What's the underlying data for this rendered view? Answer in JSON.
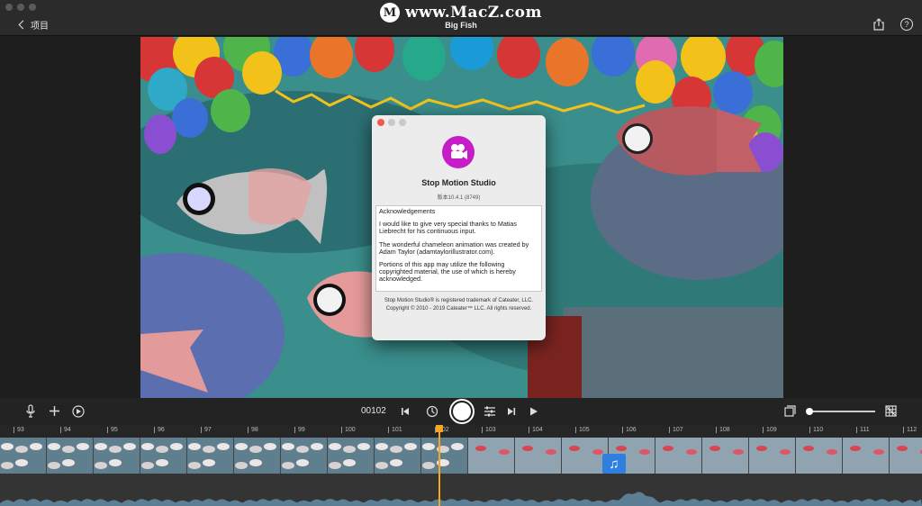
{
  "titlebar": {
    "back_label": "项目",
    "watermark_logo": "M",
    "watermark_text": "www.MacZ.com",
    "document_title": "Big Fish",
    "help_glyph": "?"
  },
  "about_dialog": {
    "app_name": "Stop Motion Studio",
    "version": "版本10.4.1 (8749)",
    "acknowledgements_heading": "Acknowledgements",
    "acknowledgements": [
      "I would like to give very special thanks to Matias Liebrecht for his continuous input.",
      "The wonderful chameleon animation was created by Adam Taylor (adamtaylorillustrator.com).",
      "Portions of this app may utilize the following copyrighted material, the use of which is hereby acknowledged."
    ],
    "trademark": "Stop Motion Studio® is registered trademark of Cateater, LLC.",
    "copyright": "Copyright © 2010 - 2019 Cateater™ LLC. All rights reserved.",
    "accent_color": "#c51dc8"
  },
  "controls": {
    "frame_number": "00102",
    "icons": [
      "microphone-icon",
      "plus-icon",
      "effects-icon",
      "skip-back-icon",
      "onion-skin-icon",
      "capture-button",
      "adjust-icon",
      "skip-forward-icon",
      "play-icon",
      "frame-view-icon",
      "grid-icon"
    ]
  },
  "timeline": {
    "tick_labels": [
      "93",
      "94",
      "95",
      "96",
      "97",
      "98",
      "99",
      "100",
      "101",
      "102",
      "103",
      "104",
      "105",
      "106",
      "107",
      "108",
      "109",
      "110",
      "111",
      "112"
    ],
    "current_frame": "102",
    "music_badge_glyph": "♫",
    "playhead_color": "#f5a623"
  }
}
